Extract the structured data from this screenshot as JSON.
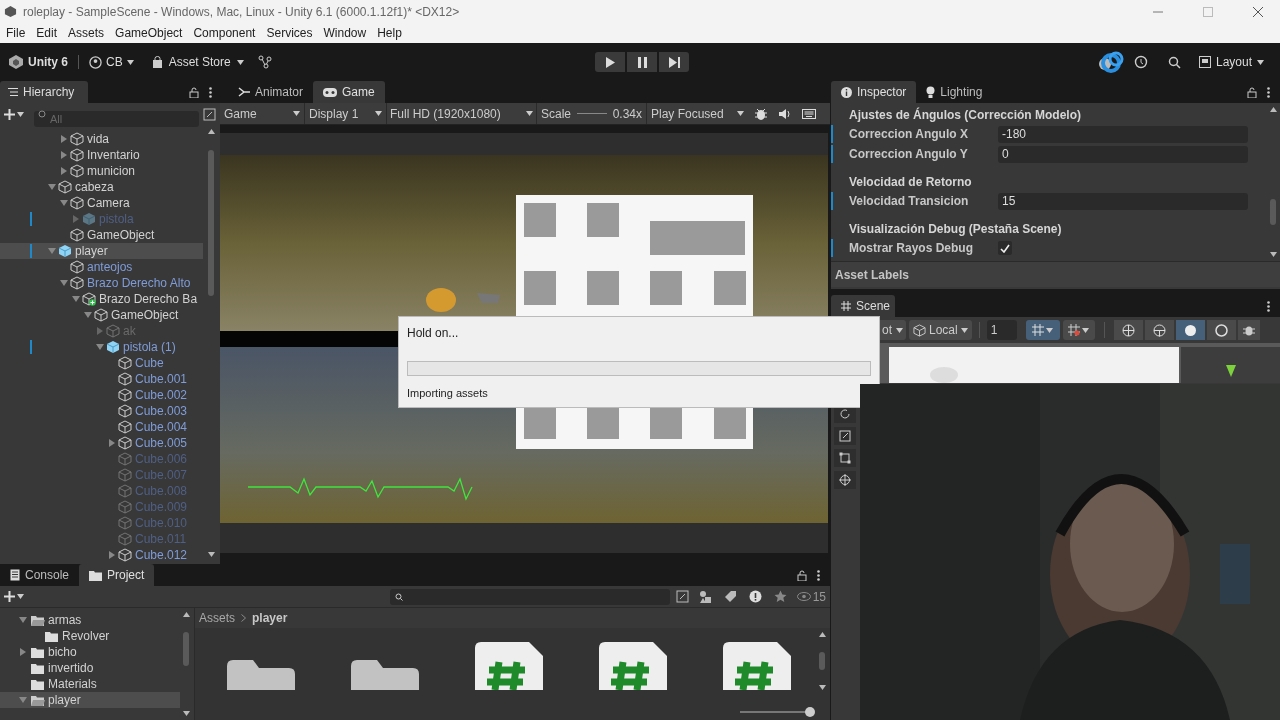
{
  "window": {
    "title": "roleplay - SampleScene - Windows, Mac, Linux - Unity 6.1 (6000.1.12f1)* <DX12>"
  },
  "menu": [
    "File",
    "Edit",
    "Assets",
    "GameObject",
    "Component",
    "Services",
    "Window",
    "Help"
  ],
  "toolbar": {
    "brand": "Unity 6",
    "account": "CB",
    "store": "Asset Store",
    "layout": "Layout"
  },
  "hierarchy": {
    "tab": "Hierarchy",
    "search_placeholder": "All",
    "items": [
      {
        "children": [
          {
            "label": "vida",
            "kind": "object",
            "blue": false,
            "disabled": false,
            "selected": false,
            "modified": false,
            "expanded": false
          },
          {
            "label": "Inventario",
            "kind": "object",
            "blue": false,
            "disabled": false,
            "selected": false,
            "modified": false,
            "expanded": false
          },
          {
            "label": "municion",
            "kind": "object",
            "blue": false,
            "disabled": false,
            "selected": false,
            "modified": false,
            "expanded": false
          }
        ]
      },
      {
        "label": "cabeza",
        "kind": "object",
        "blue": false,
        "disabled": false,
        "selected": false,
        "modified": false,
        "expanded": true,
        "children": [
          {
            "label": "Camera",
            "kind": "object",
            "blue": false,
            "disabled": false,
            "selected": false,
            "modified": false,
            "expanded": true,
            "children": [
              {
                "label": "pistola",
                "kind": "prefab",
                "blue": true,
                "disabled": true,
                "selected": false,
                "modified": true,
                "expanded": false
              }
            ]
          },
          {
            "label": "GameObject",
            "kind": "object",
            "blue": false,
            "disabled": false,
            "selected": false,
            "modified": false
          }
        ]
      },
      {
        "label": "player",
        "kind": "prefab",
        "blue": false,
        "disabled": false,
        "selected": true,
        "modified": true,
        "expanded": true,
        "children": [
          {
            "label": "anteojos",
            "kind": "object",
            "blue": true,
            "disabled": false,
            "selected": false,
            "modified": false
          },
          {
            "label": "Brazo Derecho Alto",
            "kind": "object",
            "blue": true,
            "disabled": false,
            "selected": false,
            "modified": false,
            "expanded": true,
            "children": [
              {
                "label": "Brazo Derecho Ba",
                "kind": "added",
                "blue": false,
                "disabled": false,
                "selected": false,
                "modified": false,
                "expanded": true,
                "children": [
                  {
                    "label": "GameObject",
                    "kind": "object",
                    "blue": false,
                    "disabled": false,
                    "selected": false,
                    "modified": false,
                    "expanded": true,
                    "children": [
                      {
                        "label": "ak",
                        "kind": "object",
                        "blue": false,
                        "disabled": true,
                        "selected": false,
                        "modified": false,
                        "expanded": false
                      },
                      {
                        "label": "pistola (1)",
                        "kind": "prefab",
                        "blue": true,
                        "disabled": false,
                        "selected": false,
                        "modified": true,
                        "expanded": true,
                        "children": [
                          {
                            "label": "Cube",
                            "kind": "object",
                            "blue": true,
                            "disabled": false,
                            "selected": false,
                            "modified": false
                          },
                          {
                            "label": "Cube.001",
                            "kind": "object",
                            "blue": true,
                            "disabled": false,
                            "selected": false,
                            "modified": false
                          },
                          {
                            "label": "Cube.002",
                            "kind": "object",
                            "blue": true,
                            "disabled": false,
                            "selected": false,
                            "modified": false
                          },
                          {
                            "label": "Cube.003",
                            "kind": "object",
                            "blue": true,
                            "disabled": false,
                            "selected": false,
                            "modified": false
                          },
                          {
                            "label": "Cube.004",
                            "kind": "object",
                            "blue": true,
                            "disabled": false,
                            "selected": false,
                            "modified": false
                          },
                          {
                            "label": "Cube.005",
                            "kind": "object",
                            "blue": true,
                            "disabled": false,
                            "selected": false,
                            "modified": false,
                            "expanded": false
                          },
                          {
                            "label": "Cube.006",
                            "kind": "object",
                            "blue": true,
                            "disabled": true,
                            "selected": false,
                            "modified": false
                          },
                          {
                            "label": "Cube.007",
                            "kind": "object",
                            "blue": true,
                            "disabled": true,
                            "selected": false,
                            "modified": false
                          },
                          {
                            "label": "Cube.008",
                            "kind": "object",
                            "blue": true,
                            "disabled": true,
                            "selected": false,
                            "modified": false
                          },
                          {
                            "label": "Cube.009",
                            "kind": "object",
                            "blue": true,
                            "disabled": true,
                            "selected": false,
                            "modified": false
                          },
                          {
                            "label": "Cube.010",
                            "kind": "object",
                            "blue": true,
                            "disabled": true,
                            "selected": false,
                            "modified": false
                          },
                          {
                            "label": "Cube.011",
                            "kind": "object",
                            "blue": true,
                            "disabled": true,
                            "selected": false,
                            "modified": false
                          },
                          {
                            "label": "Cube.012",
                            "kind": "object",
                            "blue": true,
                            "disabled": false,
                            "selected": false,
                            "modified": false,
                            "expanded": false
                          }
                        ]
                      }
                    ]
                  }
                ]
              }
            ]
          }
        ]
      }
    ]
  },
  "center_tabs": [
    {
      "label": "Animator",
      "selected": false
    },
    {
      "label": "Game",
      "selected": true
    }
  ],
  "game_toolbar": {
    "view": "Game",
    "display": "Display 1",
    "resolution": "Full HD (1920x1080)",
    "scale_label": "Scale",
    "scale_value": "0.34x",
    "play_mode": "Play Focused"
  },
  "dialog": {
    "title": "Hold on...",
    "progress": {
      "level": 0
    },
    "message": "Importing assets"
  },
  "inspector": {
    "tabs": [
      {
        "label": "Inspector",
        "selected": true
      },
      {
        "label": "Lighting",
        "selected": false
      }
    ],
    "rows": [
      {
        "kind": "header",
        "label": "Ajustes de Ángulos (Corrección Modelo)"
      },
      {
        "kind": "number",
        "label": "Correccion Angulo X",
        "value": "-180",
        "modified": true
      },
      {
        "kind": "number",
        "label": "Correccion Angulo Y",
        "value": "0",
        "modified": true
      },
      {
        "kind": "header",
        "label": "Velocidad de Retorno"
      },
      {
        "kind": "number",
        "label": "Velocidad Transicion",
        "value": "15",
        "modified": true
      },
      {
        "kind": "header",
        "label": "Visualización Debug (Pestaña Scene)"
      },
      {
        "kind": "checkbox",
        "label": "Mostrar Rayos Debug",
        "checked": true,
        "modified": true
      }
    ],
    "asset_labels": "Asset Labels"
  },
  "scene": {
    "tab": "Scene",
    "pivot_partial": "ot",
    "space": "Local",
    "grid_value": "1"
  },
  "bottom": {
    "tabs": [
      {
        "label": "Console",
        "selected": false
      },
      {
        "label": "Project",
        "selected": true
      }
    ],
    "visible_count": "15",
    "folders": [
      {
        "label": "armas",
        "selected": false,
        "expanded": true,
        "children": [
          {
            "label": "Revolver",
            "selected": false
          }
        ]
      },
      {
        "label": "bicho",
        "selected": false,
        "expanded": false
      },
      {
        "label": "invertido",
        "selected": false
      },
      {
        "label": "Materials",
        "selected": false
      },
      {
        "label": "player",
        "selected": true,
        "expanded": true
      }
    ],
    "breadcrumb": [
      "Assets",
      "player"
    ],
    "assets": [
      {
        "kind": "folder"
      },
      {
        "kind": "folder"
      },
      {
        "kind": "script"
      },
      {
        "kind": "script"
      },
      {
        "kind": "script"
      }
    ],
    "zoom_slider": {
      "level": 1
    }
  }
}
